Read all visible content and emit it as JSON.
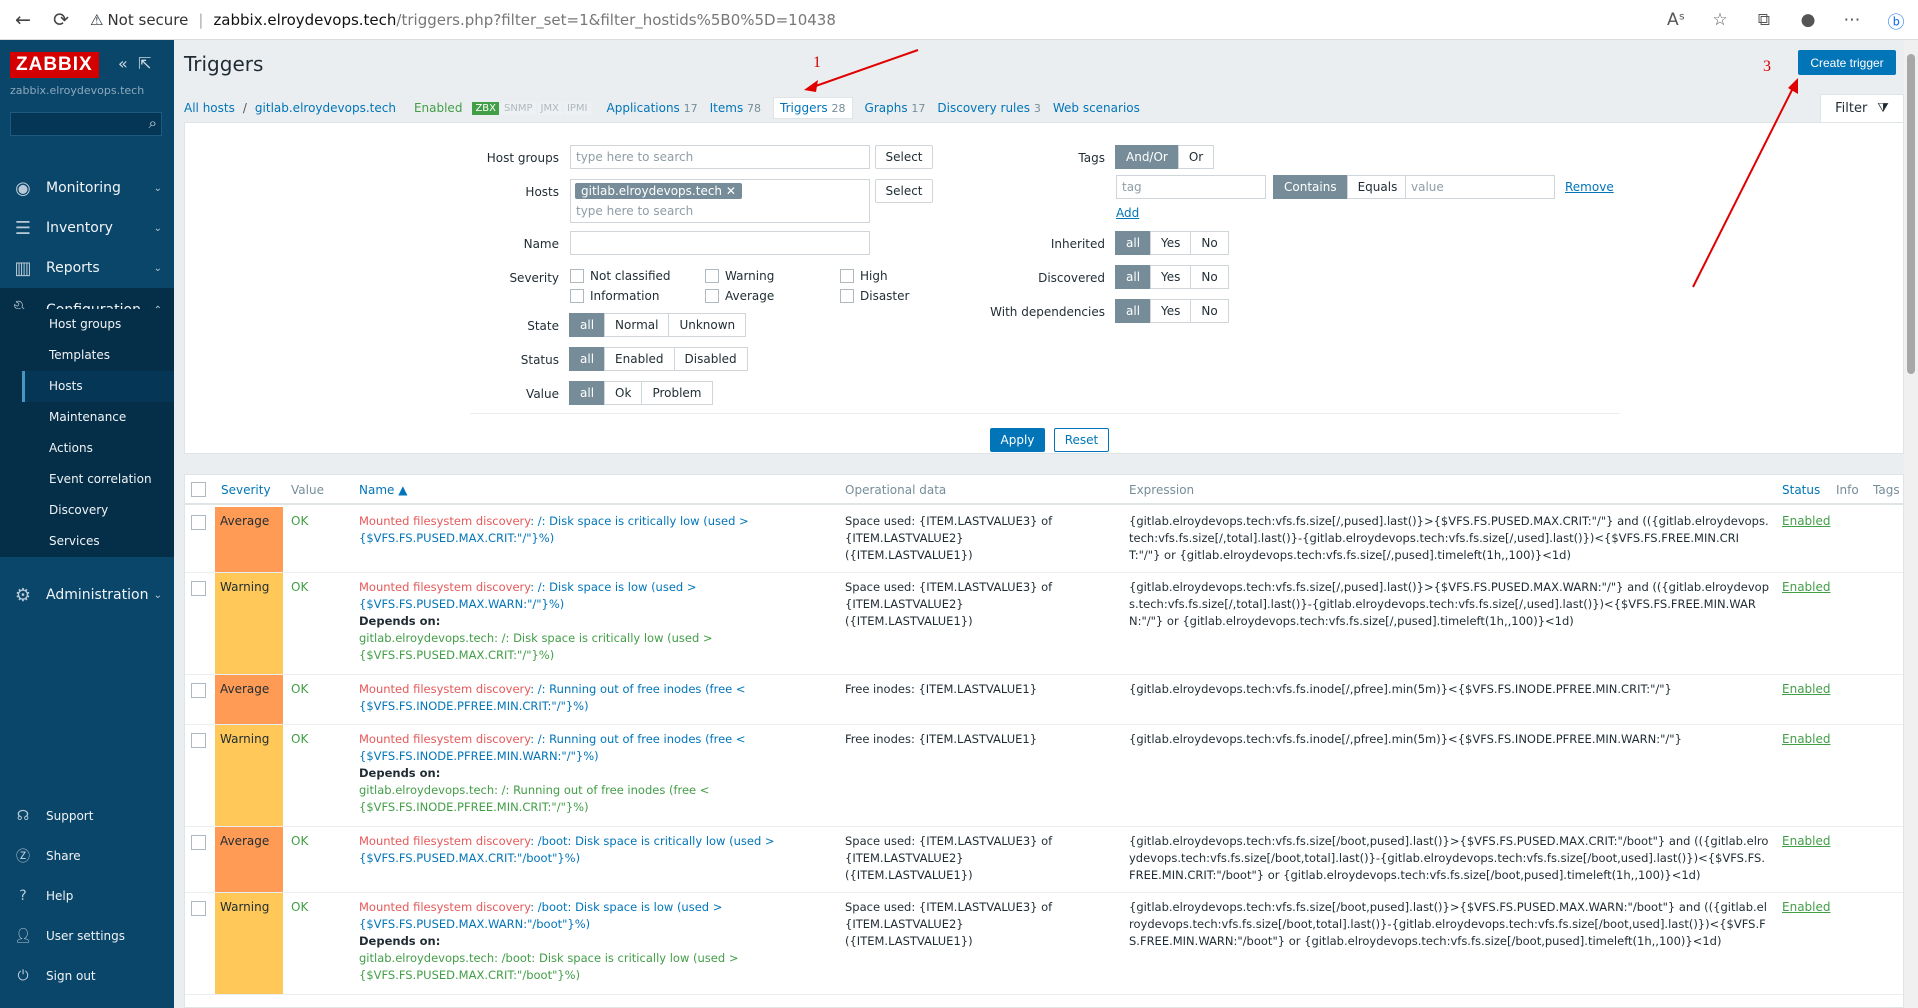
{
  "browser": {
    "security": "Not secure",
    "url_host": "zabbix.elroydevops.tech",
    "url_path": "/triggers.php?filter_set=1&filter_hostids%5B0%5D=10438"
  },
  "sidebar": {
    "logo": "ZABBIX",
    "hostname": "zabbix.elroydevops.tech",
    "menu": [
      {
        "label": "Monitoring"
      },
      {
        "label": "Inventory"
      },
      {
        "label": "Reports"
      },
      {
        "label": "Configuration"
      },
      {
        "label": "Administration"
      }
    ],
    "submenu": [
      "Host groups",
      "Templates",
      "Hosts",
      "Maintenance",
      "Actions",
      "Event correlation",
      "Discovery",
      "Services"
    ],
    "bottom": [
      "Support",
      "Share",
      "Help",
      "User settings",
      "Sign out"
    ]
  },
  "page": {
    "title": "Triggers",
    "create_button": "Create trigger"
  },
  "tabs": {
    "all_hosts": "All hosts",
    "host": "gitlab.elroydevops.tech",
    "enabled": "Enabled",
    "tags": [
      "ZBX",
      "SNMP",
      "JMX",
      "IPMI"
    ],
    "items": [
      {
        "label": "Applications",
        "count": "17"
      },
      {
        "label": "Items",
        "count": "78"
      },
      {
        "label": "Triggers",
        "count": "28"
      },
      {
        "label": "Graphs",
        "count": "17"
      },
      {
        "label": "Discovery rules",
        "count": "3"
      },
      {
        "label": "Web scenarios",
        "count": ""
      }
    ],
    "filter_label": "Filter"
  },
  "filter": {
    "host_groups_label": "Host groups",
    "hosts_label": "Hosts",
    "name_label": "Name",
    "severity_label": "Severity",
    "state_label": "State",
    "status_label": "Status",
    "value_label": "Value",
    "placeholder": "type here to search",
    "select": "Select",
    "host_chip": "gitlab.elroydevops.tech",
    "severities": [
      "Not classified",
      "Warning",
      "High",
      "Information",
      "Average",
      "Disaster"
    ],
    "state_opts": [
      "all",
      "Normal",
      "Unknown"
    ],
    "status_opts": [
      "all",
      "Enabled",
      "Disabled"
    ],
    "value_opts": [
      "all",
      "Ok",
      "Problem"
    ],
    "tags_label": "Tags",
    "tags_opts": [
      "And/Or",
      "Or"
    ],
    "tag_placeholder": "tag",
    "tag_ops": [
      "Contains",
      "Equals"
    ],
    "value_placeholder": "value",
    "remove": "Remove",
    "add": "Add",
    "inherited_label": "Inherited",
    "discovered_label": "Discovered",
    "dependencies_label": "With dependencies",
    "yn_opts": [
      "all",
      "Yes",
      "No"
    ],
    "apply": "Apply",
    "reset": "Reset"
  },
  "table": {
    "headers": {
      "severity": "Severity",
      "value": "Value",
      "name": "Name ▲",
      "opdata": "Operational data",
      "expression": "Expression",
      "status": "Status",
      "info": "Info",
      "tags": "Tags"
    },
    "rows": [
      {
        "severity": "Average",
        "value": "OK",
        "lld": "Mounted filesystem discovery",
        "name": ": /: Disk space is critically low (used > {$VFS.FS.PUSED.MAX.CRIT:\"/\"}%)",
        "depends": "",
        "dep_text": "",
        "opdata": "Space used: {ITEM.LASTVALUE3} of {ITEM.LASTVALUE2} ({ITEM.LASTVALUE1})",
        "expression": "{gitlab.elroydevops.tech:vfs.fs.size[/,pused].last()}>{$VFS.FS.PUSED.MAX.CRIT:\"/\"} and (({gitlab.elroydevops.tech:vfs.fs.size[/,total].last()}-{gitlab.elroydevops.tech:vfs.fs.size[/,used].last()})<{$VFS.FS.FREE.MIN.CRIT:\"/\"} or {gitlab.elroydevops.tech:vfs.fs.size[/,pused].timeleft(1h,,100)}<1d)",
        "status": "Enabled"
      },
      {
        "severity": "Warning",
        "value": "OK",
        "lld": "Mounted filesystem discovery",
        "name": ": /: Disk space is low (used > {$VFS.FS.PUSED.MAX.WARN:\"/\"}%)",
        "depends": "Depends on:",
        "dep_text": "gitlab.elroydevops.tech: /: Disk space is critically low (used > {$VFS.FS.PUSED.MAX.CRIT:\"/\"}%)",
        "opdata": "Space used: {ITEM.LASTVALUE3} of {ITEM.LASTVALUE2} ({ITEM.LASTVALUE1})",
        "expression": "{gitlab.elroydevops.tech:vfs.fs.size[/,pused].last()}>{$VFS.FS.PUSED.MAX.WARN:\"/\"} and (({gitlab.elroydevops.tech:vfs.fs.size[/,total].last()}-{gitlab.elroydevops.tech:vfs.fs.size[/,used].last()})<{$VFS.FS.FREE.MIN.WARN:\"/\"} or {gitlab.elroydevops.tech:vfs.fs.size[/,pused].timeleft(1h,,100)}<1d)",
        "status": "Enabled"
      },
      {
        "severity": "Average",
        "value": "OK",
        "lld": "Mounted filesystem discovery",
        "name": ": /: Running out of free inodes (free < {$VFS.FS.INODE.PFREE.MIN.CRIT:\"/\"}%)",
        "depends": "",
        "dep_text": "",
        "opdata": "Free inodes: {ITEM.LASTVALUE1}",
        "expression": "{gitlab.elroydevops.tech:vfs.fs.inode[/,pfree].min(5m)}<{$VFS.FS.INODE.PFREE.MIN.CRIT:\"/\"}",
        "status": "Enabled"
      },
      {
        "severity": "Warning",
        "value": "OK",
        "lld": "Mounted filesystem discovery",
        "name": ": /: Running out of free inodes (free < {$VFS.FS.INODE.PFREE.MIN.WARN:\"/\"}%)",
        "depends": "Depends on:",
        "dep_text": "gitlab.elroydevops.tech: /: Running out of free inodes (free < {$VFS.FS.INODE.PFREE.MIN.CRIT:\"/\"}%)",
        "opdata": "Free inodes: {ITEM.LASTVALUE1}",
        "expression": "{gitlab.elroydevops.tech:vfs.fs.inode[/,pfree].min(5m)}<{$VFS.FS.INODE.PFREE.MIN.WARN:\"/\"}",
        "status": "Enabled"
      },
      {
        "severity": "Average",
        "value": "OK",
        "lld": "Mounted filesystem discovery",
        "name": ": /boot: Disk space is critically low (used > {$VFS.FS.PUSED.MAX.CRIT:\"/boot\"}%)",
        "depends": "",
        "dep_text": "",
        "opdata": "Space used: {ITEM.LASTVALUE3} of {ITEM.LASTVALUE2} ({ITEM.LASTVALUE1})",
        "expression": "{gitlab.elroydevops.tech:vfs.fs.size[/boot,pused].last()}>{$VFS.FS.PUSED.MAX.CRIT:\"/boot\"} and (({gitlab.elroydevops.tech:vfs.fs.size[/boot,total].last()}-{gitlab.elroydevops.tech:vfs.fs.size[/boot,used].last()})<{$VFS.FS.FREE.MIN.CRIT:\"/boot\"} or {gitlab.elroydevops.tech:vfs.fs.size[/boot,pused].timeleft(1h,,100)}<1d)",
        "status": "Enabled"
      },
      {
        "severity": "Warning",
        "value": "OK",
        "lld": "Mounted filesystem discovery",
        "name": ": /boot: Disk space is low (used > {$VFS.FS.PUSED.MAX.WARN:\"/boot\"}%)",
        "depends": "Depends on:",
        "dep_text": "gitlab.elroydevops.tech: /boot: Disk space is critically low (used > {$VFS.FS.PUSED.MAX.CRIT:\"/boot\"}%)",
        "opdata": "Space used: {ITEM.LASTVALUE3} of {ITEM.LASTVALUE2} ({ITEM.LASTVALUE1})",
        "expression": "{gitlab.elroydevops.tech:vfs.fs.size[/boot,pused].last()}>{$VFS.FS.PUSED.MAX.WARN:\"/boot\"} and (({gitlab.elroydevops.tech:vfs.fs.size[/boot,total].last()}-{gitlab.elroydevops.tech:vfs.fs.size[/boot,used].last()})<{$VFS.FS.FREE.MIN.WARN:\"/boot\"} or {gitlab.elroydevops.tech:vfs.fs.size[/boot,pused].timeleft(1h,,100)}<1d)",
        "status": "Enabled"
      }
    ]
  },
  "annotations": {
    "one": "1",
    "three": "3"
  },
  "colors": {
    "sidebar": "#0a466a",
    "link": "#0275b8",
    "ok": "#429e47",
    "average": "#ff9b55",
    "warning": "#ffc859",
    "annotation": "#d10000"
  }
}
